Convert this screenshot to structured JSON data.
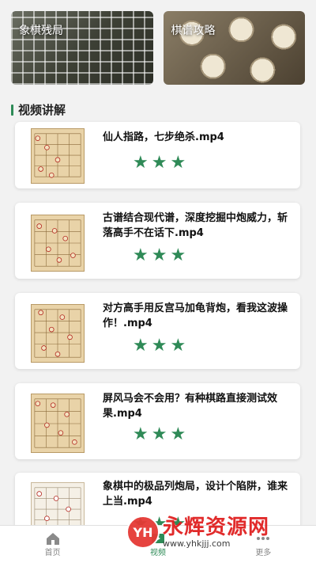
{
  "banners": [
    {
      "title": "象棋残局"
    },
    {
      "title": "棋谱攻略"
    }
  ],
  "section": {
    "title": "视频讲解"
  },
  "videos": [
    {
      "title": "仙人指路，七步绝杀.mp4",
      "rating": 3
    },
    {
      "title": "古谱结合现代谱，深度挖掘中炮威力，斩落高手不在话下.mp4",
      "rating": 3
    },
    {
      "title": "对方高手用反宫马加龟背炮，看我这波操作！.mp4",
      "rating": 3
    },
    {
      "title": "屏风马会不会用？有种棋路直接测试效果.mp4",
      "rating": 3
    },
    {
      "title": "象棋中的极品列炮局，设计个陷阱，谁来上当.mp4",
      "rating": 3
    }
  ],
  "tabs": [
    {
      "label": "首页",
      "icon": "home-icon"
    },
    {
      "label": "视频",
      "icon": "video-icon"
    },
    {
      "label": "更多",
      "icon": "more-icon"
    }
  ],
  "watermark": {
    "logo": "YH",
    "title": "永辉资源网",
    "url": "www.yhkjjj.com"
  },
  "colors": {
    "accent": "#2e8b57",
    "star": "#2f8a57",
    "watermark": "#e02020"
  }
}
